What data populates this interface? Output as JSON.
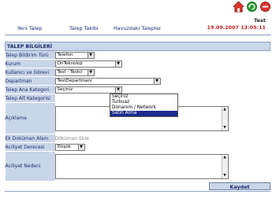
{
  "nav": {
    "items": [
      "Yeni Talep",
      "Talep Takibi",
      "Havuzdaki Talepler"
    ]
  },
  "user": {
    "name": "Test",
    "datetime": "19.09.2007 13:05:11"
  },
  "icons": {
    "home": "home-icon",
    "refresh": "refresh-icon",
    "exit": "exit-icon"
  },
  "form": {
    "title": "TALEP BİLGİLERİ",
    "labels": {
      "bildirim_turu": "Talep Bildirim Türü",
      "kurum": "Kurum",
      "kullanici": "Kullanıcı ve Görevi",
      "departman": "Departman",
      "ana_kategori": "Talep Ana Kategori",
      "alt_kategori": "Talep Alt Kategorisi",
      "aciklama": "Açıklama",
      "ek_dokuman": "Ek Doküman Alanı",
      "aciliyet_derecesi": "Aciliyet Derecesi",
      "aciliyet_nedeni": "Aciliyet Nedeni"
    },
    "values": {
      "bildirim_turu": "Telefon",
      "kurum": "OnTeknoloji",
      "kullanici": "Test - Testci",
      "departman": "TestDepartmani",
      "ana_kategori": "Seçiniz",
      "ek_dokuman_link": "Döküman Ekle",
      "aciliyet_derecesi": "Düşük"
    },
    "ana_kategori_options": [
      "Seçiniz",
      "Turkuaz",
      "Donanım / Network",
      "Satın Alma"
    ],
    "ana_kategori_highlighted": "Satın Alma",
    "save_label": "Kaydet"
  },
  "colors": {
    "label_bg": "#c9d5e8",
    "date_red": "#c02020",
    "nav_blue": "#1c2b78",
    "highlight": "#1b2b8c"
  }
}
